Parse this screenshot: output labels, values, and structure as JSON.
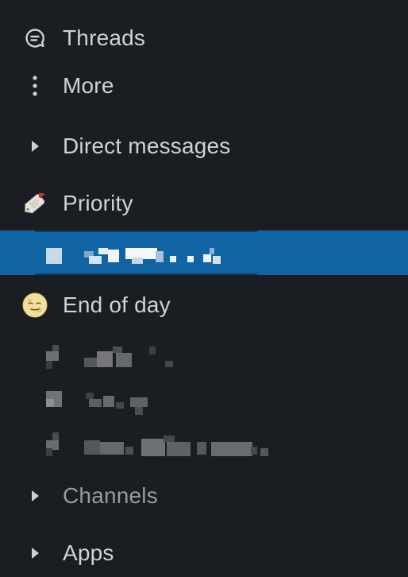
{
  "sidebar": {
    "threads": {
      "label": "Threads",
      "icon": "threads-icon"
    },
    "more": {
      "label": "More",
      "icon": "vertical-ellipsis-icon"
    },
    "direct_messages": {
      "label": "Direct messages",
      "icon": "caret-right-icon"
    },
    "priority": {
      "label": "Priority",
      "icon": "tag-label-icon"
    },
    "selected_item": {
      "label": "",
      "redacted": true
    },
    "end_of_day": {
      "label": "End of day",
      "icon": "moon-face-icon"
    },
    "end_of_day_items": [
      {
        "label": "",
        "redacted": true
      },
      {
        "label": "",
        "redacted": true
      },
      {
        "label": "",
        "redacted": true
      }
    ],
    "channels": {
      "label": "Channels",
      "icon": "caret-right-icon"
    },
    "apps": {
      "label": "Apps",
      "icon": "caret-right-icon"
    }
  },
  "colors": {
    "background": "#1a1d21",
    "selected": "#1164a3",
    "text": "#d1d2d3",
    "muted_text": "#9a9b9d"
  }
}
